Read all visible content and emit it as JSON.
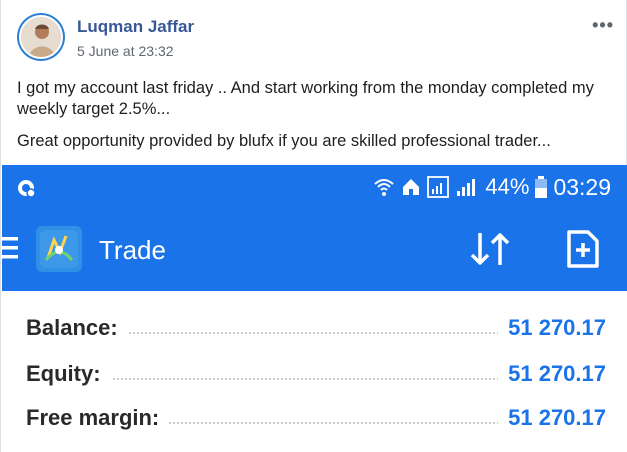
{
  "post": {
    "author": "Luqman Jaffar",
    "date": "5 June at 23:32",
    "more": "•••",
    "paragraphs": [
      "I got my account last friday .. And start working from the monday completed my weekly target 2.5%...",
      "Great opportunity provided by blufx if you are skilled professional trader..."
    ]
  },
  "phone": {
    "status": {
      "battery": "44%",
      "time": "03:29",
      "icons": [
        "whatsapp-icon",
        "wifi-icon",
        "home-icon",
        "signal-icon",
        "battery-icon"
      ]
    },
    "appbar": {
      "title": "Trade",
      "icons": [
        "menu-icon",
        "metatrader-logo-icon",
        "sort-icon",
        "new-order-icon"
      ]
    },
    "account": [
      {
        "label": "Balance:",
        "value": "51 270.17"
      },
      {
        "label": "Equity:",
        "value": "51 270.17"
      },
      {
        "label": "Free margin:",
        "value": "51 270.17"
      }
    ],
    "colors": {
      "accent": "#1a73e8",
      "label": "#2a2a2a"
    }
  }
}
